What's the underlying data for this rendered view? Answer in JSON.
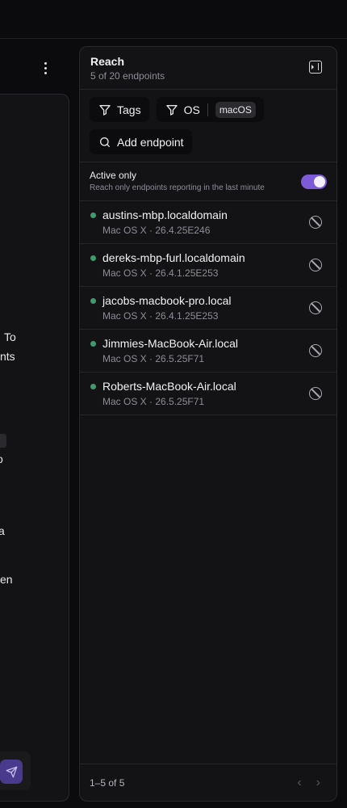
{
  "left": {
    "fragments": [
      "To",
      "nts",
      "o",
      "a",
      "en"
    ]
  },
  "panel": {
    "title": "Reach",
    "subtitle": "5 of 20 endpoints",
    "filters": {
      "tags_label": "Tags",
      "os_label": "OS",
      "os_value": "macOS",
      "add_label": "Add endpoint"
    },
    "active_only": {
      "title": "Active only",
      "description": "Reach only endpoints reporting in the last minute",
      "enabled": true
    },
    "endpoints": [
      {
        "name": "austins-mbp.localdomain",
        "os": "Mac OS X · 26.4.25E246"
      },
      {
        "name": "dereks-mbp-furl.localdomain",
        "os": "Mac OS X · 26.4.1.25E253"
      },
      {
        "name": "jacobs-macbook-pro.local",
        "os": "Mac OS X · 26.4.1.25E253"
      },
      {
        "name": "Jimmies-MacBook-Air.local",
        "os": "Mac OS X · 26.5.25F71"
      },
      {
        "name": "Roberts-MacBook-Air.local",
        "os": "Mac OS X · 26.5.25F71"
      }
    ],
    "pagination": {
      "range": "1–5 of 5",
      "prev": "‹",
      "next": "›"
    }
  },
  "colors": {
    "accent": "#7c5ad8",
    "status_online": "#3f9a6e"
  }
}
